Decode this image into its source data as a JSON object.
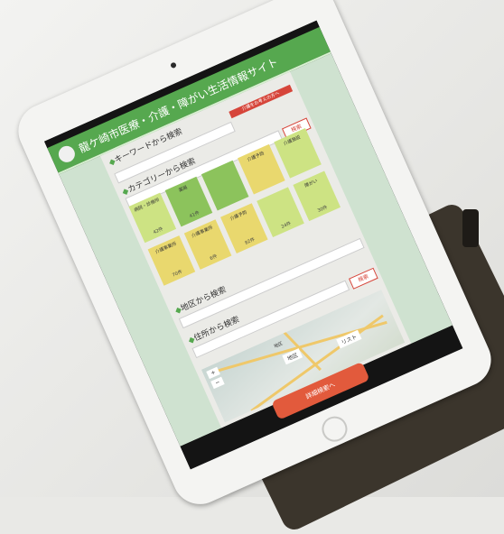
{
  "site": {
    "title": "龍ケ崎市医療・介護・障がい生活情報サイト"
  },
  "sections": {
    "keyword": {
      "title": "キーワードから検索",
      "button": "介護をお考えの方へ"
    },
    "category": {
      "title": "カテゴリーから検索",
      "button": "検索"
    },
    "area": {
      "title": "地区から検索"
    },
    "address": {
      "title": "住所から検索",
      "button": "検索"
    }
  },
  "categories": [
    {
      "label": "病院・診療所",
      "count": "42件"
    },
    {
      "label": "薬局",
      "count": "41件"
    },
    {
      "label": "",
      "count": ""
    },
    {
      "label": "介護予防",
      "count": ""
    },
    {
      "label": "介護施設",
      "count": ""
    },
    {
      "label": "介護事業所",
      "count": "70件"
    },
    {
      "label": "介護事業所",
      "count": "6件"
    },
    {
      "label": "介護予防",
      "count": "82件"
    },
    {
      "label": "",
      "count": "24件"
    },
    {
      "label": "障がい",
      "count": "30件"
    }
  ],
  "map": {
    "toolbar_label": "地区",
    "buttons": [
      "地区",
      "リスト"
    ]
  },
  "cta": {
    "label": "詳細検索へ"
  },
  "colors": {
    "header_green": "#56a84f",
    "cell_light": "#cde383",
    "cell_dark": "#8cc35c",
    "cell_gold": "#e9d86e",
    "accent_red": "#d6453a"
  }
}
